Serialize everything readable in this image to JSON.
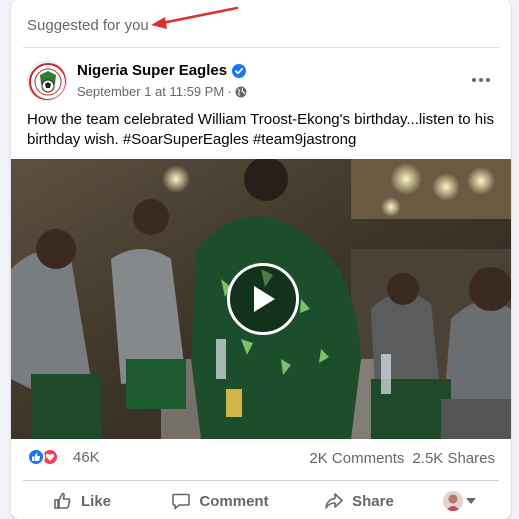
{
  "feed": {
    "suggested_label": "Suggested for you"
  },
  "post": {
    "page_name": "Nigeria Super Eagles",
    "timestamp": "September 1 at 11:59 PM",
    "separator": "·",
    "text": "How the team celebrated William Troost-Ekong's birthday...listen to his birthday wish. #SoarSuperEagles #team9jastrong",
    "reactions_count": "46K",
    "comments_count": "2K Comments",
    "shares_count": "2.5K Shares"
  },
  "actions": {
    "like_label": "Like",
    "comment_label": "Comment",
    "share_label": "Share"
  },
  "icons": {
    "verified": "verified-badge-icon",
    "audience": "globe-icon",
    "more": "more-horizontal-icon",
    "play": "play-icon",
    "like_reaction": "like-reaction-icon",
    "love_reaction": "love-reaction-icon",
    "like": "thumbs-up-icon",
    "comment": "comment-bubble-icon",
    "share": "share-arrow-icon"
  },
  "colors": {
    "accent": "#1877f2",
    "love": "#f33e58",
    "annotation_arrow": "#d9312b",
    "muted_text": "#65676b"
  }
}
